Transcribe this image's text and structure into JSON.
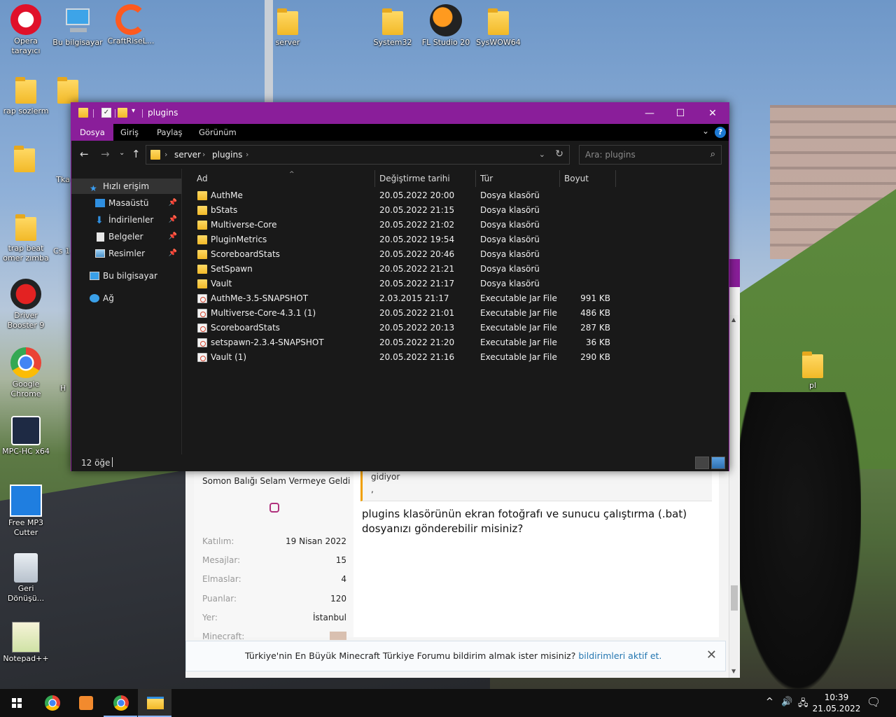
{
  "desktop": {
    "icons": [
      {
        "label": "Opera tarayıcı"
      },
      {
        "label": "Bu bilgisayar"
      },
      {
        "label": "CraftRiseL..."
      },
      {
        "label": "server"
      },
      {
        "label": "System32"
      },
      {
        "label": "FL Studio 20"
      },
      {
        "label": "SysWOW64"
      },
      {
        "label": "rap sozlerm"
      },
      {
        "label": "trap beat omer zımba"
      },
      {
        "label": "Driver Booster 9"
      },
      {
        "label": "Google Chrome"
      },
      {
        "label": "MPC-HC x64"
      },
      {
        "label": "Free MP3 Cutter"
      },
      {
        "label": "Geri Dönüşü..."
      },
      {
        "label": "Notepad++"
      },
      {
        "label": "pl"
      },
      {
        "label": "Cs 1"
      },
      {
        "label": "Tka"
      },
      {
        "label": "H"
      }
    ]
  },
  "browser": {
    "user_title": "Somon Balığı Selam Vermeye Geldi",
    "stats": [
      {
        "label": "Katılım:",
        "value": "19 Nisan 2022"
      },
      {
        "label": "Mesajlar:",
        "value": "15"
      },
      {
        "label": "Elmaslar:",
        "value": "4"
      },
      {
        "label": "Puanlar:",
        "value": "120"
      },
      {
        "label": "Yer:",
        "value": "İstanbul"
      },
      {
        "label": "Minecraft:",
        "value": ""
      }
    ],
    "quote_text": "gidiyor",
    "quote_comma": ",",
    "post_text": "plugins klasörünün ekran fotoğrafı ve sunucu çalıştırma (.bat) dosyanızı gönderebilir misiniz?",
    "notify_text": "Türkiye'nin En Büyük Minecraft Türkiye Forumu bildirim almak ister misiniz? ",
    "notify_link": "bildirimleri aktif et.",
    "notify_close": "✕"
  },
  "explorer": {
    "title": "plugins",
    "ribbon_tabs": [
      "Dosya",
      "Giriş",
      "Paylaş",
      "Görünüm"
    ],
    "help": "?",
    "address": [
      "server",
      "plugins"
    ],
    "search_placeholder": "Ara: plugins",
    "nav": [
      {
        "label": "Hızlı erişim"
      },
      {
        "label": "Masaüstü"
      },
      {
        "label": "İndirilenler"
      },
      {
        "label": "Belgeler"
      },
      {
        "label": "Resimler"
      },
      {
        "label": "Bu bilgisayar"
      },
      {
        "label": "Ağ"
      }
    ],
    "columns": [
      "Ad",
      "Değiştirme tarihi",
      "Tür",
      "Boyut"
    ],
    "files": [
      {
        "name": "AuthMe",
        "date": "20.05.2022 20:00",
        "type": "Dosya klasörü",
        "size": "",
        "kind": "folder"
      },
      {
        "name": "bStats",
        "date": "20.05.2022 21:15",
        "type": "Dosya klasörü",
        "size": "",
        "kind": "folder"
      },
      {
        "name": "Multiverse-Core",
        "date": "20.05.2022 21:02",
        "type": "Dosya klasörü",
        "size": "",
        "kind": "folder"
      },
      {
        "name": "PluginMetrics",
        "date": "20.05.2022 19:54",
        "type": "Dosya klasörü",
        "size": "",
        "kind": "folder"
      },
      {
        "name": "ScoreboardStats",
        "date": "20.05.2022 20:46",
        "type": "Dosya klasörü",
        "size": "",
        "kind": "folder"
      },
      {
        "name": "SetSpawn",
        "date": "20.05.2022 21:21",
        "type": "Dosya klasörü",
        "size": "",
        "kind": "folder"
      },
      {
        "name": "Vault",
        "date": "20.05.2022 21:17",
        "type": "Dosya klasörü",
        "size": "",
        "kind": "folder"
      },
      {
        "name": "AuthMe-3.5-SNAPSHOT",
        "date": "2.03.2015 21:17",
        "type": "Executable Jar File",
        "size": "991 KB",
        "kind": "jar"
      },
      {
        "name": "Multiverse-Core-4.3.1 (1)",
        "date": "20.05.2022 21:01",
        "type": "Executable Jar File",
        "size": "486 KB",
        "kind": "jar"
      },
      {
        "name": "ScoreboardStats",
        "date": "20.05.2022 20:13",
        "type": "Executable Jar File",
        "size": "287 KB",
        "kind": "jar"
      },
      {
        "name": "setspawn-2.3.4-SNAPSHOT",
        "date": "20.05.2022 21:20",
        "type": "Executable Jar File",
        "size": "36 KB",
        "kind": "jar"
      },
      {
        "name": "Vault (1)",
        "date": "20.05.2022 21:16",
        "type": "Executable Jar File",
        "size": "290 KB",
        "kind": "jar"
      }
    ],
    "status_count": "12 öğe"
  },
  "taskbar": {
    "time": "10:39",
    "date": "21.05.2022"
  },
  "colors": {
    "accent": "#8a1e9a",
    "explorer_bg": "#191919",
    "folder": "#f2b928",
    "link": "#2577b1"
  }
}
